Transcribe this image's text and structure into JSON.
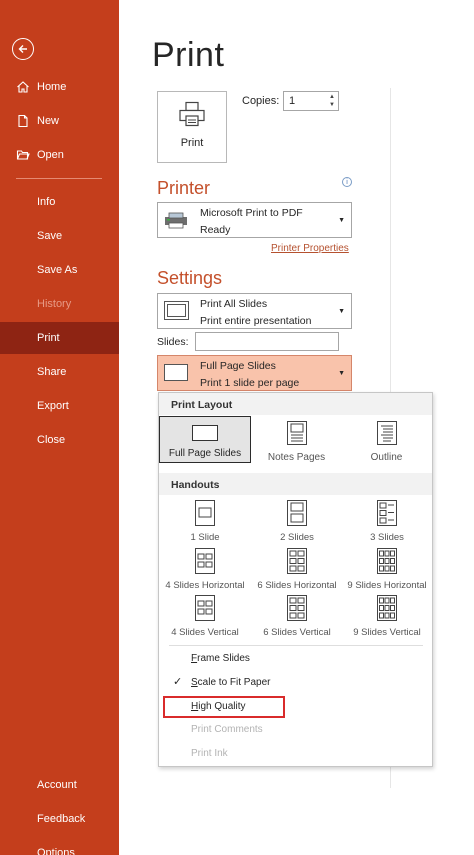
{
  "sidebar": {
    "items": [
      {
        "label": "Home",
        "icon": "home-icon"
      },
      {
        "label": "New",
        "icon": "new-document-icon"
      },
      {
        "label": "Open",
        "icon": "folder-open-icon"
      },
      {
        "label": "Info"
      },
      {
        "label": "Save"
      },
      {
        "label": "Save As"
      },
      {
        "label": "History",
        "disabled": true
      },
      {
        "label": "Print",
        "active": true
      },
      {
        "label": "Share"
      },
      {
        "label": "Export"
      },
      {
        "label": "Close"
      },
      {
        "label": "Account"
      },
      {
        "label": "Feedback"
      },
      {
        "label": "Options"
      }
    ],
    "bg_color": "#c43e1c",
    "active_color": "#8e2413"
  },
  "page": {
    "title": "Print"
  },
  "print_button": {
    "label": "Print"
  },
  "copies": {
    "label": "Copies:",
    "value": "1"
  },
  "printer": {
    "heading": "Printer",
    "name": "Microsoft Print to PDF",
    "status": "Ready",
    "properties_link": "Printer Properties"
  },
  "settings": {
    "heading": "Settings",
    "range": {
      "line1": "Print All Slides",
      "line2": "Print entire presentation"
    },
    "slides_label": "Slides:",
    "layout": {
      "line1": "Full Page Slides",
      "line2": "Print 1 slide per page"
    }
  },
  "popup": {
    "print_layout_heading": "Print Layout",
    "layouts": [
      "Full Page Slides",
      "Notes Pages",
      "Outline"
    ],
    "handouts_heading": "Handouts",
    "handouts": [
      "1 Slide",
      "2 Slides",
      "3 Slides",
      "4 Slides Horizontal",
      "6 Slides Horizontal",
      "9 Slides Horizontal",
      "4 Slides Vertical",
      "6 Slides Vertical",
      "9 Slides Vertical"
    ],
    "options": {
      "frame_slides": {
        "key": "F",
        "rest": "rame Slides"
      },
      "scale_to_fit": {
        "key": "S",
        "rest": "cale to Fit Paper"
      },
      "high_quality": {
        "key": "H",
        "rest": "igh Quality"
      },
      "print_comments": "Print Comments",
      "print_ink": "Print Ink"
    },
    "highlight_color": "#d92b2b"
  }
}
